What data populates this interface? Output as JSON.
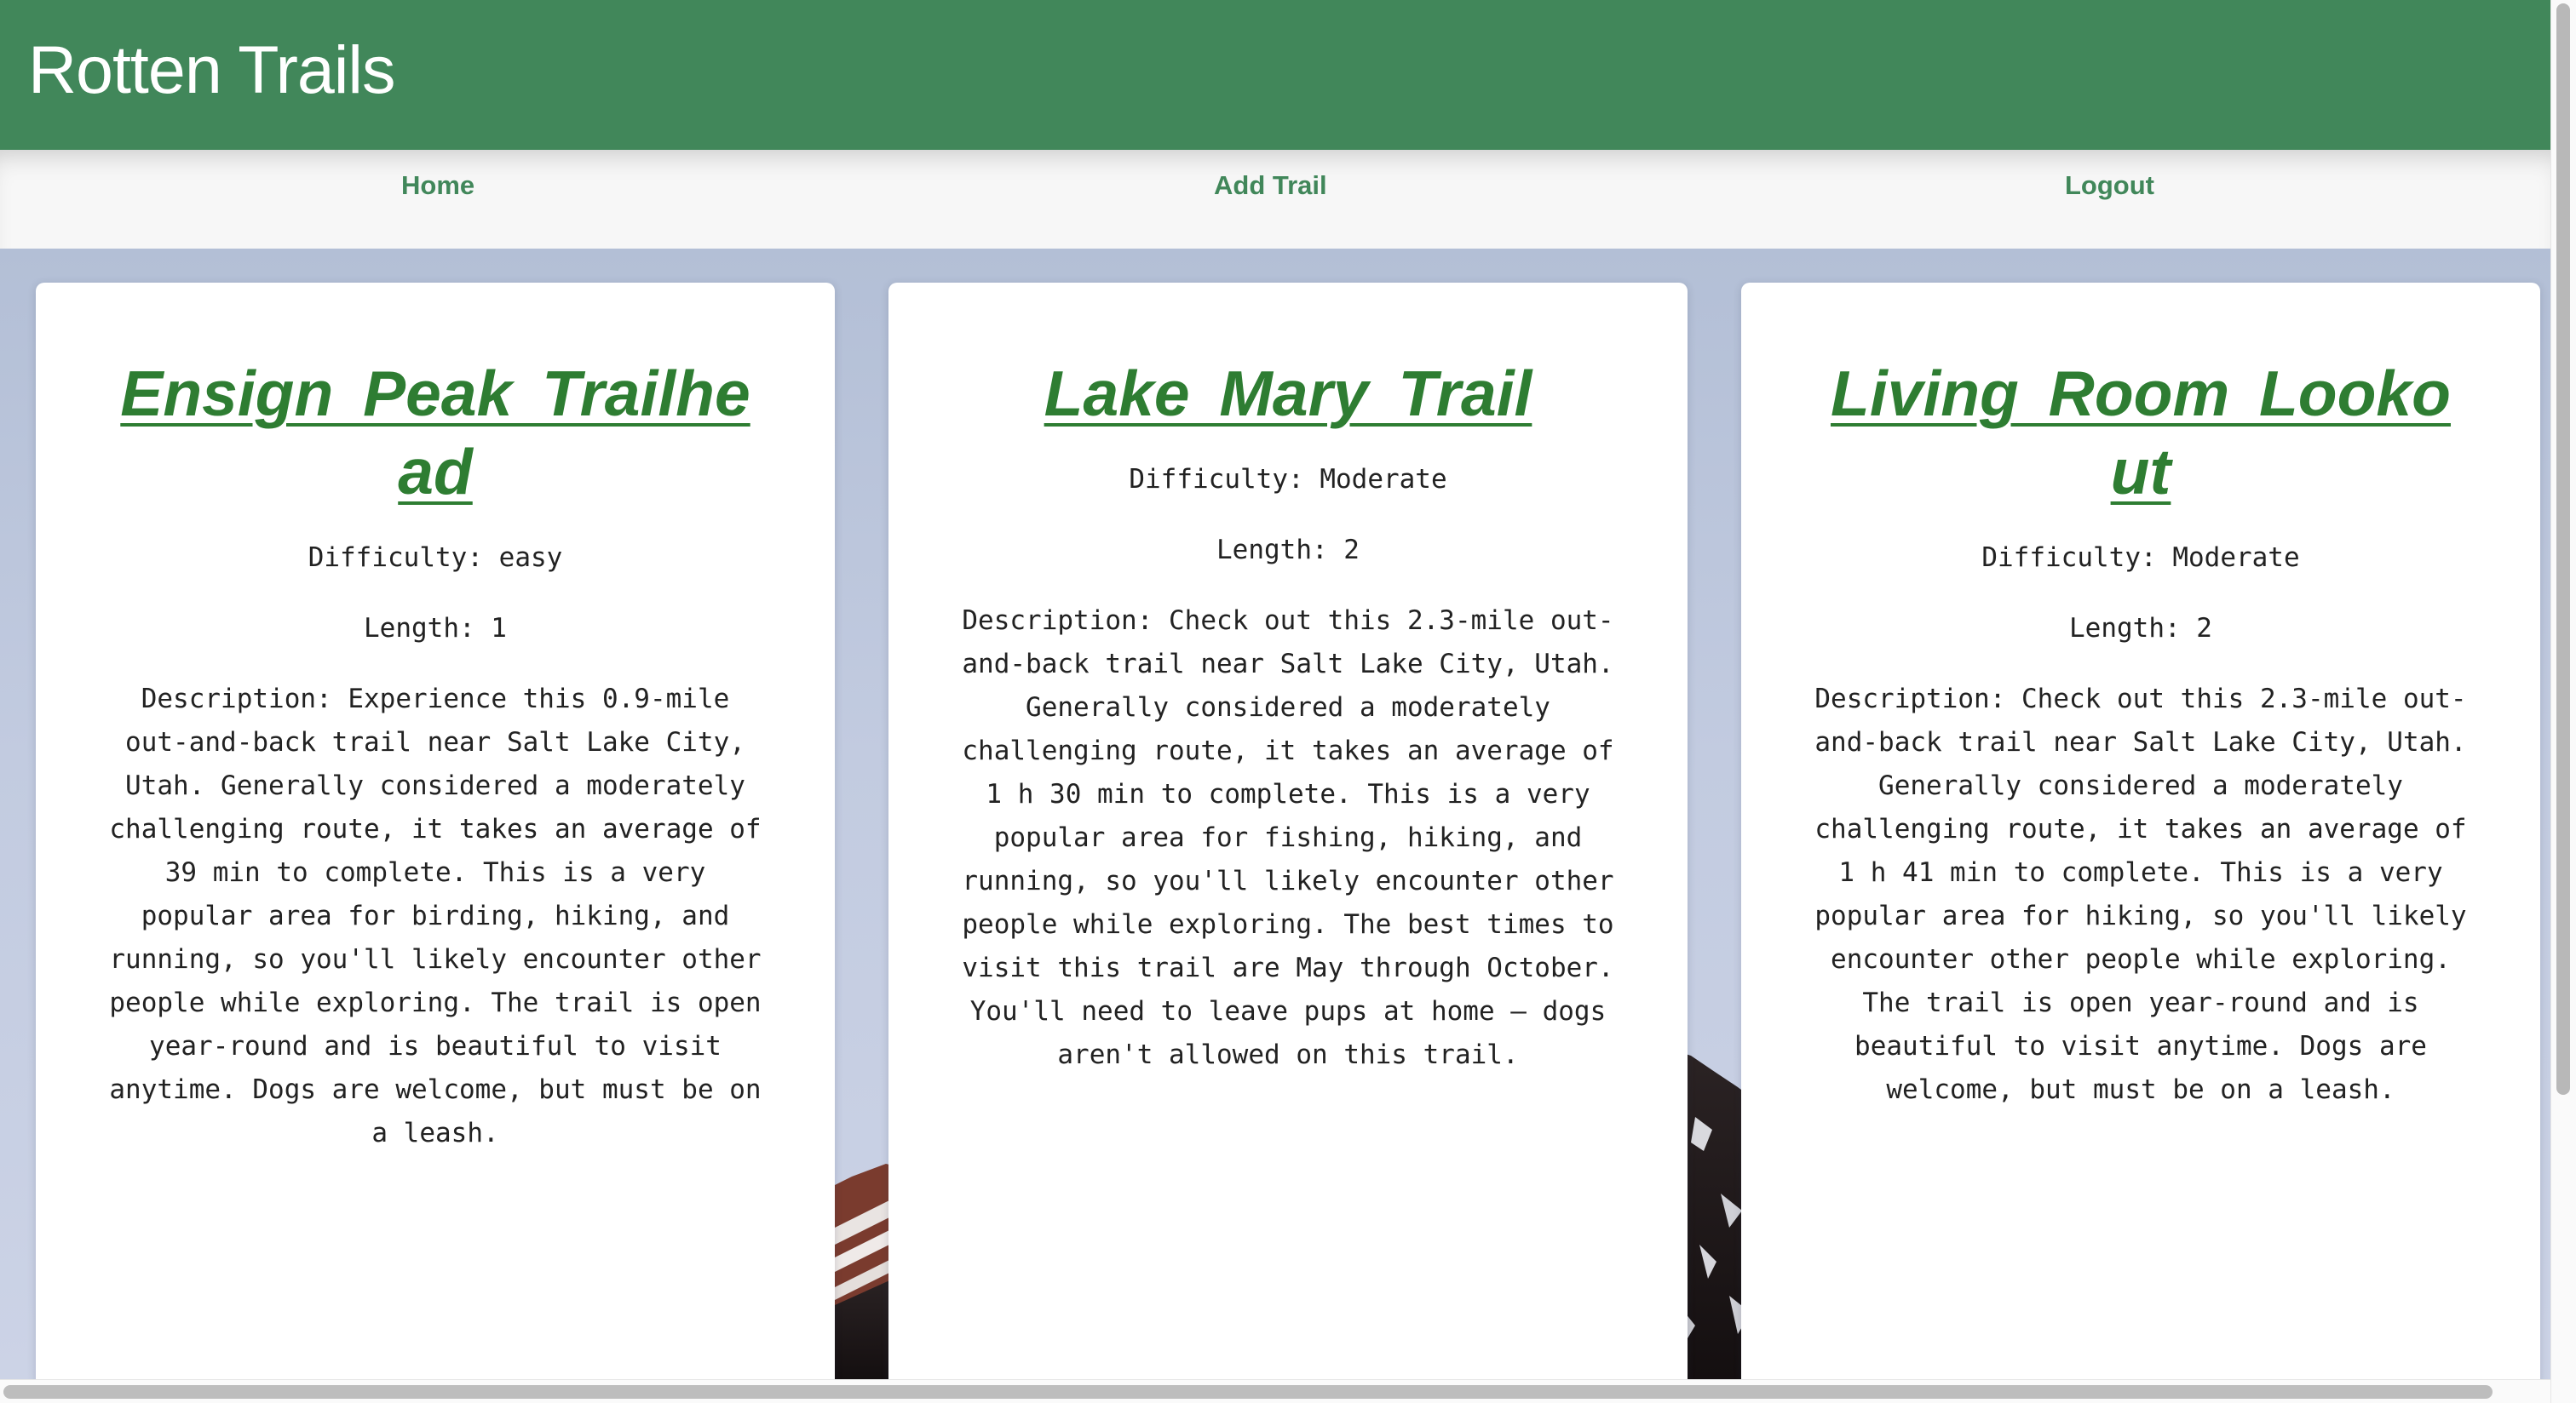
{
  "app": {
    "title": "Rotten Trails",
    "brand_color": "#41875a",
    "link_color": "#2e7d32"
  },
  "nav": {
    "items": [
      {
        "label": "Home"
      },
      {
        "label": "Add Trail"
      },
      {
        "label": "Logout"
      }
    ]
  },
  "background": {
    "image_subject": "mountain-landscape"
  },
  "trails": [
    {
      "name": "Ensign Peak Trailhead",
      "difficulty": "Difficulty: easy",
      "length": "Length: 1",
      "description": "Description: Experience this 0.9-mile out-and-back trail near Salt Lake City, Utah. Generally considered a moderately challenging route, it takes an average of 39 min to complete. This is a very popular area for birding, hiking, and running, so you'll likely encounter other people while exploring. The trail is open year-round and is beautiful to visit anytime. Dogs are welcome, but must be on a leash."
    },
    {
      "name": "Lake Mary Trail",
      "difficulty": "Difficulty: Moderate",
      "length": "Length: 2",
      "description": "Description: Check out this 2.3-mile out-and-back trail near Salt Lake City, Utah. Generally considered a moderately challenging route, it takes an average of 1 h 30 min to complete. This is a very popular area for fishing, hiking, and running, so you'll likely encounter other people while exploring. The best times to visit this trail are May through October. You'll need to leave pups at home — dogs aren't allowed on this trail."
    },
    {
      "name": "Living Room Lookout",
      "difficulty": "Difficulty: Moderate",
      "length": "Length: 2",
      "description": "Description: Check out this 2.3-mile out-and-back trail near Salt Lake City, Utah. Generally considered a moderately challenging route, it takes an average of 1 h 41 min to complete. This is a very popular area for hiking, so you'll likely encounter other people while exploring. The trail is open year-round and is beautiful to visit anytime. Dogs are welcome, but must be on a leash."
    }
  ]
}
